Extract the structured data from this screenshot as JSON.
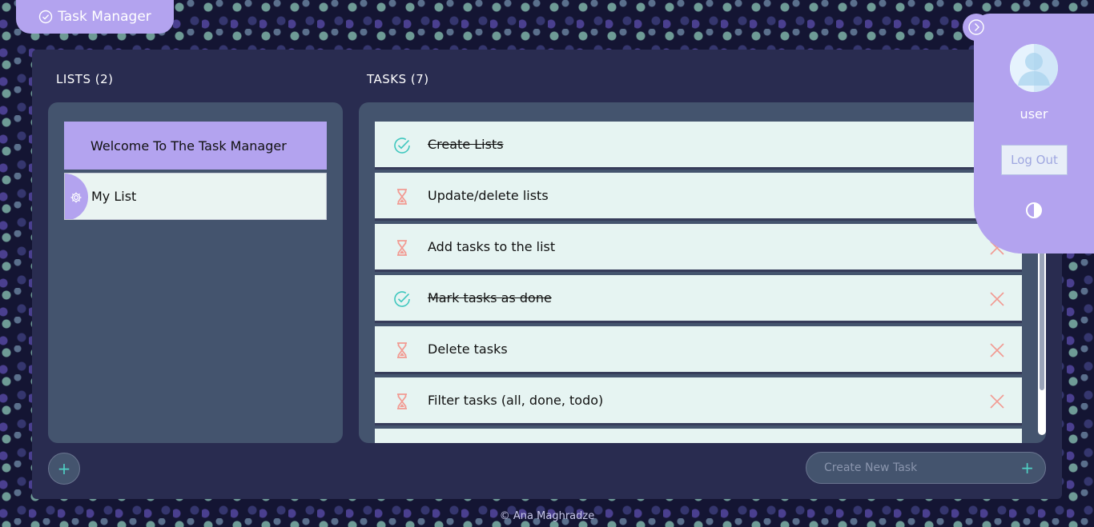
{
  "brand": {
    "title": "Task Manager",
    "icon": "check-circle-icon"
  },
  "lists": {
    "title": "LISTS (2)",
    "items": [
      {
        "label": "Welcome To The Task Manager",
        "active": true
      },
      {
        "label": "My List",
        "active": false,
        "icon": "gear-icon"
      }
    ],
    "add_label": "+"
  },
  "tasks": {
    "title": "TASKS (7)",
    "items": [
      {
        "label": "Create Lists",
        "done": true
      },
      {
        "label": "Update/delete lists",
        "done": false
      },
      {
        "label": "Add tasks to the list",
        "done": false
      },
      {
        "label": "Mark tasks as done",
        "done": true
      },
      {
        "label": "Delete tasks",
        "done": false
      },
      {
        "label": "Filter tasks (all, done, todo)",
        "done": false
      }
    ],
    "new_task_placeholder": "Create New Task",
    "new_task_add": "+"
  },
  "user": {
    "name": "user",
    "logout_label": "Log Out",
    "toggle_icon": "chevron-right-circle-icon",
    "theme_icon": "contrast-icon"
  },
  "footer": {
    "text": "© Ana Maghradze"
  },
  "colors": {
    "accent": "#b3a3ef",
    "panel": "#292c50",
    "box": "#44546e",
    "done": "#3ec7be",
    "pending": "#f29a92",
    "delete": "#f29a92"
  }
}
